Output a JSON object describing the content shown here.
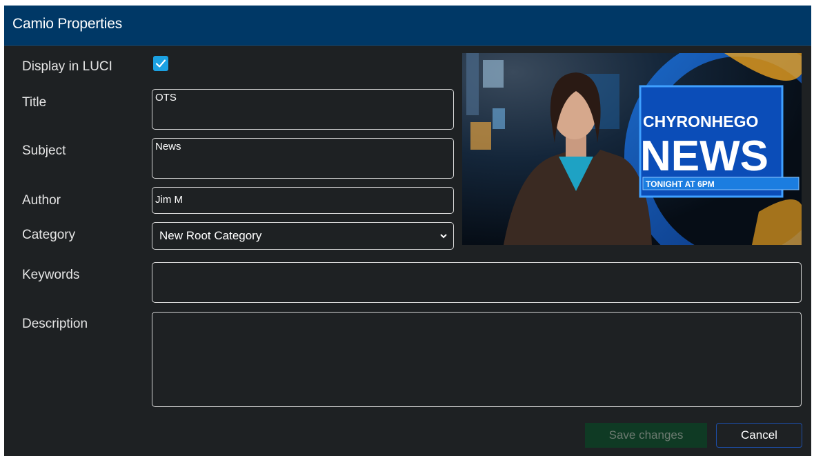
{
  "dialog": {
    "title": "Camio Properties"
  },
  "form": {
    "display_label": "Display in LUCI",
    "display_checked": true,
    "title_label": "Title",
    "title_value": "OTS",
    "subject_label": "Subject",
    "subject_value": "News",
    "author_label": "Author",
    "author_value": "Jim M",
    "category_label": "Category",
    "category_value": "New Root Category",
    "keywords_label": "Keywords",
    "keywords_value": "",
    "description_label": "Description",
    "description_value": ""
  },
  "preview": {
    "brand_line1": "CHYRONHEGO",
    "brand_line2": "NEWS",
    "tagline": "TONIGHT AT 6PM"
  },
  "buttons": {
    "save": "Save changes",
    "cancel": "Cancel"
  },
  "colors": {
    "titlebar": "#003866",
    "background": "#1e2123",
    "checkbox": "#1ba1e2",
    "save_button": "#0f3a24"
  }
}
